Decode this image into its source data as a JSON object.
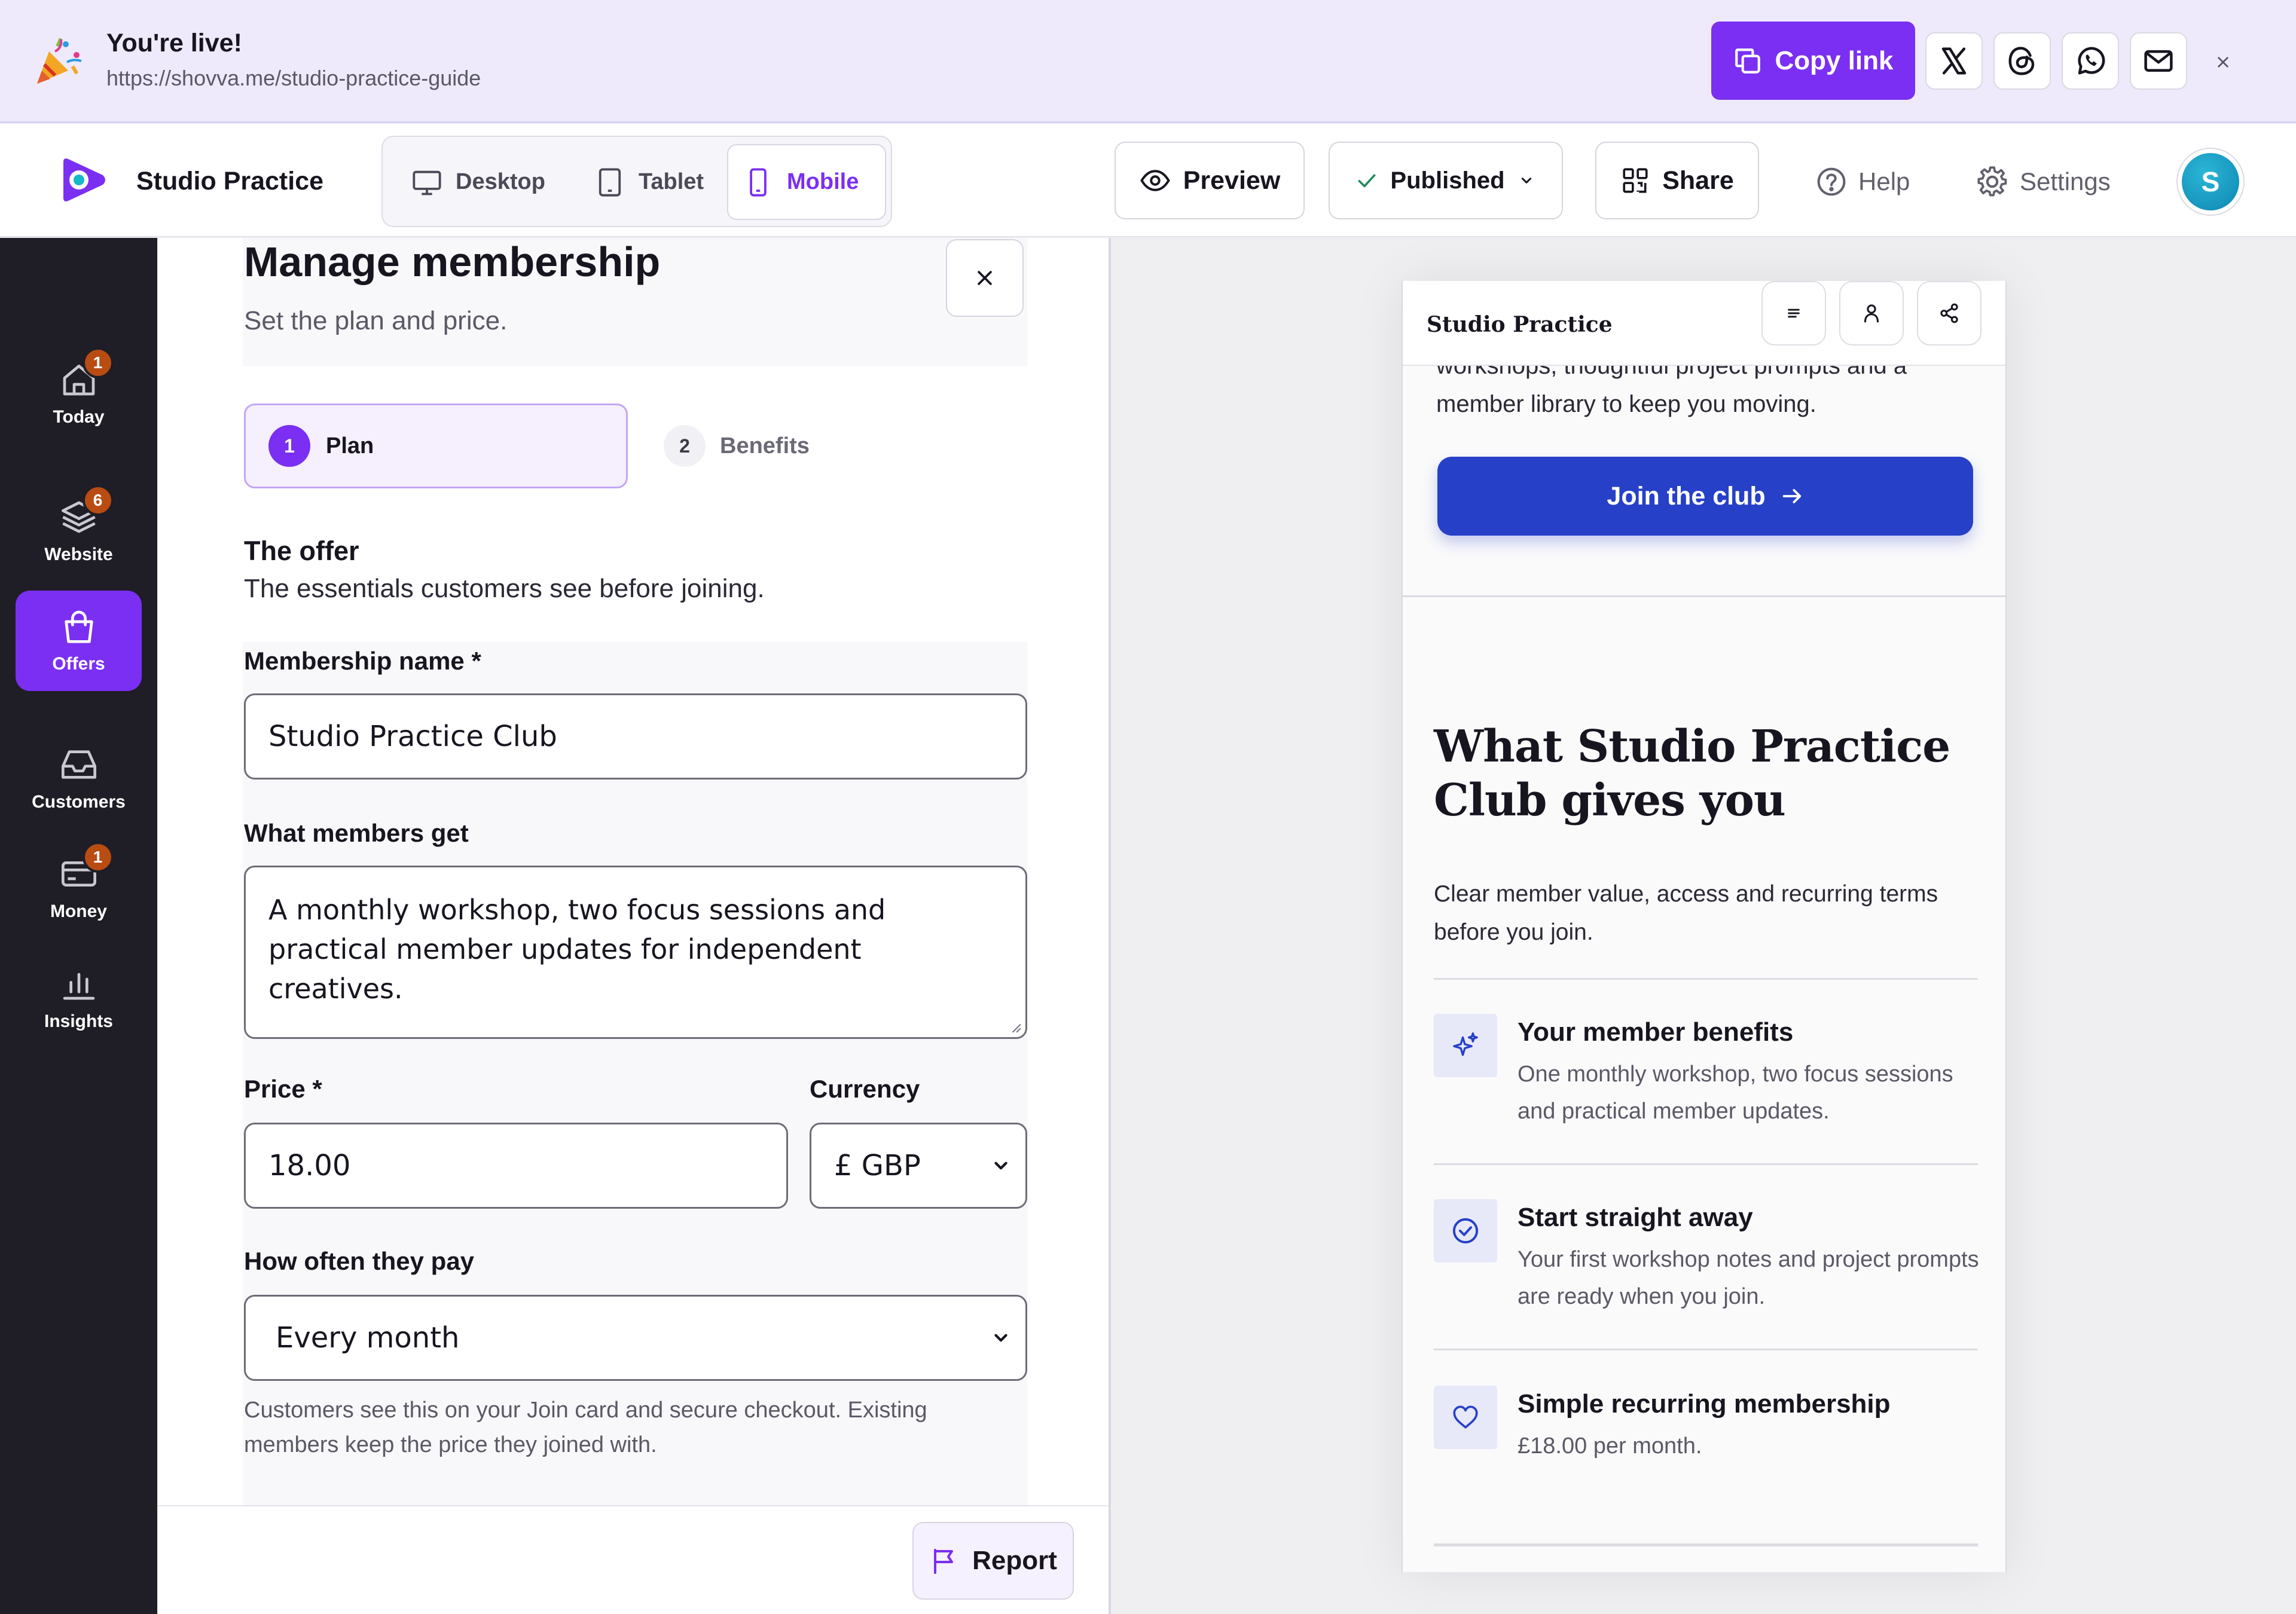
{
  "banner": {
    "title": "You're live!",
    "url": "https://shovva.me/studio-practice-guide",
    "copy_link_label": "Copy link",
    "share_icons": [
      "x-icon",
      "threads-icon",
      "whatsapp-icon",
      "mail-icon"
    ],
    "close_glyph": "×"
  },
  "topbar": {
    "brand": "Studio Practice",
    "devices": [
      {
        "label": "Desktop",
        "icon": "desktop-icon",
        "active": false
      },
      {
        "label": "Tablet",
        "icon": "tablet-icon",
        "active": false
      },
      {
        "label": "Mobile",
        "icon": "mobile-icon",
        "active": true
      }
    ],
    "preview_label": "Preview",
    "published_label": "Published",
    "share_label": "Share",
    "help_label": "Help",
    "settings_label": "Settings",
    "avatar_initial": "S"
  },
  "sidenav": {
    "items": [
      {
        "label": "Today",
        "icon": "home-icon",
        "badge": "1",
        "active": false
      },
      {
        "label": "Website",
        "icon": "layers-icon",
        "badge": "6",
        "active": false
      },
      {
        "label": "Offers",
        "icon": "shopping-bag-icon",
        "badge": "",
        "active": true
      },
      {
        "label": "Customers",
        "icon": "inbox-icon",
        "badge": "",
        "active": false
      },
      {
        "label": "Money",
        "icon": "credit-card-icon",
        "badge": "1",
        "active": false
      },
      {
        "label": "Insights",
        "icon": "bar-chart-icon",
        "badge": "",
        "active": false
      }
    ]
  },
  "editor": {
    "title": "Manage membership",
    "subtitle": "Set the plan and price.",
    "steps": [
      {
        "number": "1",
        "label": "Plan",
        "active": true
      },
      {
        "number": "2",
        "label": "Benefits",
        "active": false
      }
    ],
    "offer_title": "The offer",
    "offer_text": "The essentials customers see before joining.",
    "name_label": "Membership name *",
    "name_value": "Studio Practice Club",
    "members_get_label": "What members get",
    "members_get_value": "A monthly workshop, two focus sessions and practical member updates for independent creatives.",
    "price_label": "Price *",
    "price_value": "18.00",
    "currency_label": "Currency",
    "currency_value": "£ GBP",
    "frequency_label": "How often they pay",
    "frequency_value": "Every month",
    "helper_text": "Customers see this on your Join card and secure checkout. Existing members keep the price they joined with.",
    "report_label": "Report"
  },
  "preview": {
    "brand": "Studio Practice",
    "cut_text": "workshops, thoughtful project prompts and a member library to keep you moving.",
    "join_label": "Join the club",
    "gives_title": "What Studio Practice Club gives you",
    "gives_sub": "Clear member value, access and recurring terms before you join.",
    "benefits": [
      {
        "icon": "sparkles-icon",
        "title": "Your member benefits",
        "text": "One monthly workshop, two focus sessions and practical member updates."
      },
      {
        "icon": "check-circle-icon",
        "title": "Start straight away",
        "text": "Your first workshop notes and project prompts are ready when you join."
      },
      {
        "icon": "heart-icon",
        "title": "Simple recurring membership",
        "text": "£18.00 per month."
      }
    ]
  },
  "colors": {
    "accent": "#7b2ff2",
    "join_button": "#2640c8",
    "badge": "#b94c12",
    "sidebar": "#1f1d26",
    "banner": "#eeeafb"
  }
}
